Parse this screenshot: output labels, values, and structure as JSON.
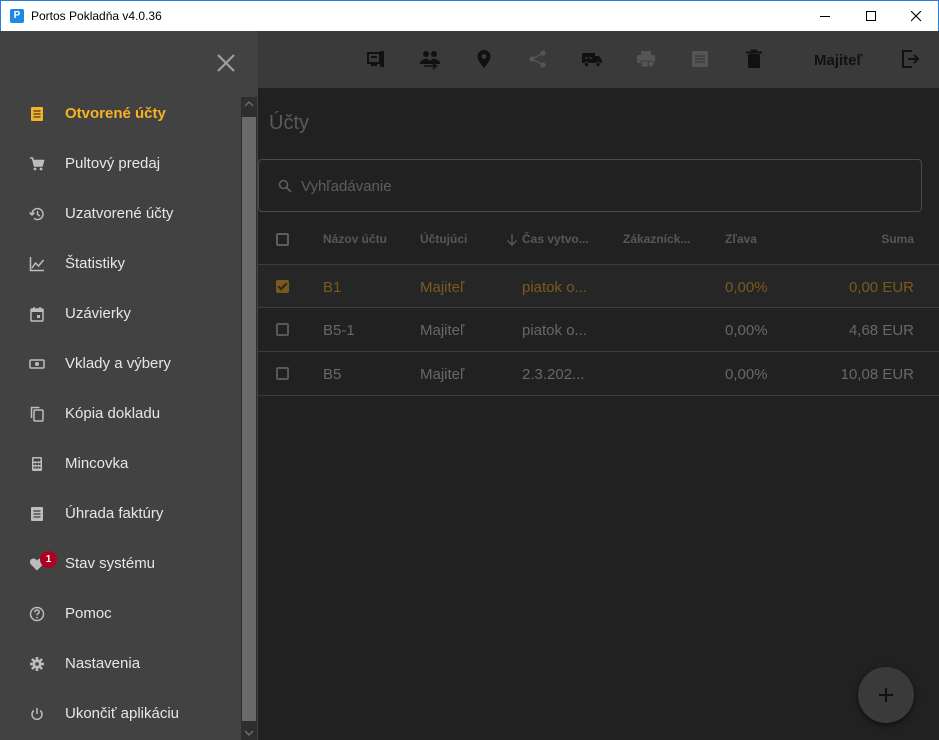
{
  "window": {
    "title": "Portos Pokladňa v4.0.36",
    "app_icon_glyph": "P",
    "controls": [
      "minimize-icon",
      "maximize-icon",
      "close-icon"
    ]
  },
  "toolbar": {
    "icons": [
      "pos-terminal-icon",
      "customers-icon",
      "location-pin-icon",
      "share-icon",
      "delivery-truck-icon",
      "printer-icon",
      "receipt-icon",
      "trash-icon"
    ],
    "user_label": "Majiteľ",
    "logout_icon": "logout-icon"
  },
  "drawer": {
    "close_icon": "close-icon",
    "items": [
      {
        "label": "Otvorené účty",
        "icon": "receipt-icon",
        "active": true
      },
      {
        "label": "Pultový predaj",
        "icon": "cart-icon"
      },
      {
        "label": "Uzatvorené účty",
        "icon": "history-icon"
      },
      {
        "label": "Štatistiky",
        "icon": "line-chart-icon"
      },
      {
        "label": "Uzávierky",
        "icon": "calendar-icon"
      },
      {
        "label": "Vklady a výbery",
        "icon": "cash-icon"
      },
      {
        "label": "Kópia dokladu",
        "icon": "copy-icon"
      },
      {
        "label": "Mincovka",
        "icon": "calculator-icon"
      },
      {
        "label": "Úhrada faktúry",
        "icon": "invoice-icon"
      },
      {
        "label": "Stav systému",
        "icon": "heart-icon",
        "badge": "1"
      },
      {
        "label": "Pomoc",
        "icon": "help-icon"
      },
      {
        "label": "Nastavenia",
        "icon": "gear-icon"
      },
      {
        "label": "Ukončiť aplikáciu",
        "icon": "power-icon"
      }
    ]
  },
  "main": {
    "title": "Účty",
    "search": {
      "placeholder": "Vyhľadávanie",
      "value": ""
    },
    "table": {
      "columns": [
        "Názov účtu",
        "Účtujúci",
        "Čas vytvo...",
        "Zákazníck...",
        "Zľava",
        "Suma"
      ],
      "sort_column": "Čas vytvo...",
      "sort_direction": "descending",
      "rows": [
        {
          "selected": true,
          "name": "B1",
          "user": "Majiteľ",
          "created": "piatok o...",
          "customer": "",
          "discount": "0,00%",
          "sum": "0,00 EUR"
        },
        {
          "selected": false,
          "name": "B5-1",
          "user": "Majiteľ",
          "created": "piatok o...",
          "customer": "",
          "discount": "0,00%",
          "sum": "4,68 EUR"
        },
        {
          "selected": false,
          "name": "B5",
          "user": "Majiteľ",
          "created": "2.3.202...",
          "customer": "",
          "discount": "0,00%",
          "sum": "10,08 EUR"
        }
      ]
    },
    "fab_icon": "plus-icon"
  },
  "colors": {
    "accent": "#f5b323",
    "selected_text": "#7a5a1c",
    "drawer_bg": "#424242",
    "toolbar_bg": "#3a3a3a",
    "content_bg": "#212121",
    "badge": "#b00020"
  }
}
